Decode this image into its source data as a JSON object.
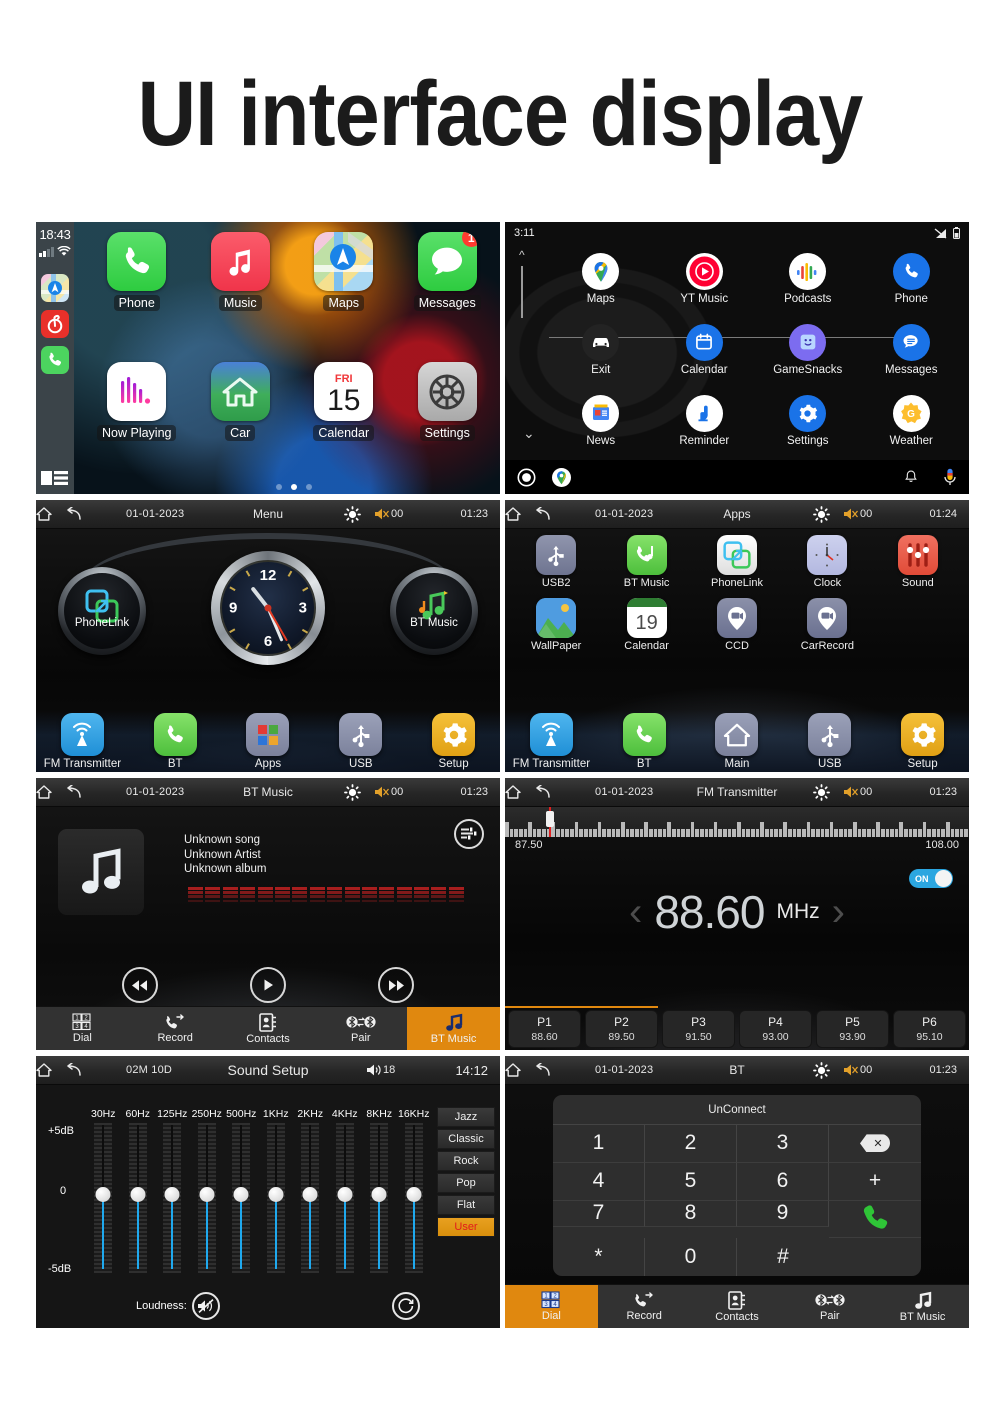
{
  "page": {
    "title": "UI interface display"
  },
  "colors": {
    "accent_orange": "#e0880f",
    "toggle_blue": "#2ba6e0",
    "slider_blue": "#1fa9ee",
    "eq_red": "#b02020",
    "badge_red": "#ff3b30"
  },
  "carplay": {
    "status": {
      "time": "18:43",
      "signal_icon": "cellular-signal-icon",
      "wifi_icon": "wifi-icon"
    },
    "sidebar_apps": [
      {
        "name": "maps-icon",
        "label": "Maps"
      },
      {
        "name": "netease-music-icon",
        "label": "NetEase Music"
      },
      {
        "name": "phone-icon",
        "label": "Phone"
      }
    ],
    "sidebar_list_button": "app-list-icon",
    "apps": [
      {
        "label": "Phone",
        "icon": "phone-icon",
        "badge": ""
      },
      {
        "label": "Music",
        "icon": "music-note-icon",
        "badge": ""
      },
      {
        "label": "Maps",
        "icon": "maps-icon",
        "badge": ""
      },
      {
        "label": "Messages",
        "icon": "messages-bubble-icon",
        "badge": "1"
      },
      {
        "label": "Now Playing",
        "icon": "now-playing-icon",
        "badge": ""
      },
      {
        "label": "Car",
        "icon": "home-house-icon",
        "badge": ""
      },
      {
        "label": "Calendar",
        "icon": "calendar-icon",
        "badge": "",
        "day_name": "FRI",
        "day_num": "15"
      },
      {
        "label": "Settings",
        "icon": "gear-icon",
        "badge": ""
      }
    ],
    "page_dots": 3,
    "page_active": 2
  },
  "androidauto": {
    "status": {
      "time": "3:11",
      "signal_icon": "no-signal-icon",
      "battery_icon": "battery-icon"
    },
    "apps": [
      {
        "label": "Maps",
        "icon": "google-maps-icon"
      },
      {
        "label": "YT Music",
        "icon": "youtube-music-icon"
      },
      {
        "label": "Podcasts",
        "icon": "google-podcasts-icon"
      },
      {
        "label": "Phone",
        "icon": "phone-icon"
      },
      {
        "label": "Exit",
        "icon": "car-exit-icon"
      },
      {
        "label": "Calendar",
        "icon": "calendar-icon"
      },
      {
        "label": "GameSnacks",
        "icon": "gamesnacks-icon"
      },
      {
        "label": "Messages",
        "icon": "messages-icon"
      },
      {
        "label": "News",
        "icon": "google-news-icon"
      },
      {
        "label": "Reminder",
        "icon": "reminder-icon"
      },
      {
        "label": "Settings",
        "icon": "gear-icon"
      },
      {
        "label": "Weather",
        "icon": "weather-icon"
      }
    ],
    "bottom_bar": {
      "home_icon": "home-circle-icon",
      "maps_icon": "google-maps-icon",
      "notification_icon": "bell-icon",
      "mic_icon": "assistant-mic-icon"
    },
    "scroll_up_icon": "chevron-up-icon",
    "scroll_down_icon": "chevron-down-icon"
  },
  "menu": {
    "topbar": {
      "home_icon": "home-icon",
      "back_icon": "back-arrow-icon",
      "date": "01-01-2023",
      "title": "Menu",
      "brightness_icon": "brightness-icon",
      "volume_icon": "volume-mute-icon",
      "volume": "00",
      "time": "01:23"
    },
    "left_gauge": {
      "label": "PhoneLink",
      "icon": "phonelink-icon"
    },
    "right_gauge": {
      "label": "BT Music",
      "icon": "music-note-icon"
    },
    "clock": {
      "numerals": [
        "12",
        "3",
        "6",
        "9"
      ]
    },
    "dock": [
      {
        "label": "FM Transmitter",
        "icon": "fm-antenna-icon"
      },
      {
        "label": "BT",
        "icon": "phone-icon"
      },
      {
        "label": "Apps",
        "icon": "apps-grid-icon"
      },
      {
        "label": "USB",
        "icon": "usb-icon"
      },
      {
        "label": "Setup",
        "icon": "gear-icon"
      }
    ]
  },
  "apps": {
    "topbar": {
      "home_icon": "home-icon",
      "back_icon": "back-arrow-icon",
      "date": "01-01-2023",
      "title": "Apps",
      "brightness_icon": "brightness-icon",
      "volume_icon": "volume-mute-icon",
      "volume": "00",
      "time": "01:24"
    },
    "items": [
      {
        "label": "USB2",
        "icon": "usb-icon"
      },
      {
        "label": "BT Music",
        "icon": "bt-music-icon"
      },
      {
        "label": "PhoneLink",
        "icon": "phonelink-icon"
      },
      {
        "label": "Clock",
        "icon": "clock-icon"
      },
      {
        "label": "Sound",
        "icon": "sound-sliders-icon"
      },
      {
        "label": "WallPaper",
        "icon": "wallpaper-icon"
      },
      {
        "label": "Calendar",
        "icon": "calendar-icon",
        "day_num": "19"
      },
      {
        "label": "CCD",
        "icon": "camera-pin-icon"
      },
      {
        "label": "CarRecord",
        "icon": "camera-pin-icon"
      }
    ],
    "dock": [
      {
        "label": "FM Transmitter",
        "icon": "fm-antenna-icon"
      },
      {
        "label": "BT",
        "icon": "phone-icon"
      },
      {
        "label": "Main",
        "icon": "home-house-icon"
      },
      {
        "label": "USB",
        "icon": "usb-icon"
      },
      {
        "label": "Setup",
        "icon": "gear-icon"
      }
    ]
  },
  "btmusic": {
    "topbar": {
      "home_icon": "home-icon",
      "back_icon": "back-arrow-icon",
      "date": "01-01-2023",
      "title": "BT Music",
      "brightness_icon": "brightness-icon",
      "volume_icon": "volume-mute-icon",
      "volume": "00",
      "time": "01:23"
    },
    "album_art_icon": "music-note-icon",
    "track": {
      "song": "Unknown song",
      "artist": "Unknown Artist",
      "album": "Unknown album"
    },
    "eq_button_icon": "equalizer-icon",
    "transport": [
      {
        "name": "previous-track-button",
        "icon": "prev-icon"
      },
      {
        "name": "play-button",
        "icon": "play-icon"
      },
      {
        "name": "next-track-button",
        "icon": "next-icon"
      }
    ],
    "nav": [
      {
        "label": "Dial",
        "icon": "dialpad-icon",
        "active": false
      },
      {
        "label": "Record",
        "icon": "call-record-icon",
        "active": false
      },
      {
        "label": "Contacts",
        "icon": "contacts-book-icon",
        "active": false
      },
      {
        "label": "Pair",
        "icon": "bluetooth-pair-icon",
        "active": false
      },
      {
        "label": "BT Music",
        "icon": "music-note-icon",
        "active": true
      }
    ]
  },
  "fm": {
    "topbar": {
      "home_icon": "home-icon",
      "back_icon": "back-arrow-icon",
      "date": "01-01-2023",
      "title": "FM Transmitter",
      "brightness_icon": "brightness-icon",
      "volume_icon": "volume-mute-icon",
      "volume": "00",
      "time": "01:23"
    },
    "range_min": "87.50",
    "range_max": "108.00",
    "frequency": "88.60",
    "unit": "MHz",
    "toggle": {
      "label": "ON",
      "state": "on"
    },
    "prev_icon": "chevron-left-icon",
    "next_icon": "chevron-right-icon",
    "presets": [
      {
        "name": "P1",
        "freq": "88.60"
      },
      {
        "name": "P2",
        "freq": "89.50"
      },
      {
        "name": "P3",
        "freq": "91.50"
      },
      {
        "name": "P4",
        "freq": "93.00"
      },
      {
        "name": "P5",
        "freq": "93.90"
      },
      {
        "name": "P6",
        "freq": "95.10"
      }
    ]
  },
  "sound": {
    "topbar": {
      "home_icon": "home-icon",
      "back_icon": "back-arrow-icon",
      "date": "02M 10D",
      "title": "Sound Setup",
      "volume_icon": "volume-on-icon",
      "volume": "18",
      "time": "14:12"
    },
    "db_labels": {
      "top": "+5dB",
      "mid": "0",
      "bottom": "-5dB"
    },
    "bands": [
      "30Hz",
      "60Hz",
      "125Hz",
      "250Hz",
      "500Hz",
      "1KHz",
      "2KHz",
      "4KHz",
      "8KHz",
      "16KHz"
    ],
    "band_values": [
      0,
      0,
      0,
      0,
      0,
      0,
      0,
      0,
      0,
      0
    ],
    "presets": [
      {
        "label": "Jazz",
        "selected": false
      },
      {
        "label": "Classic",
        "selected": false
      },
      {
        "label": "Rock",
        "selected": false
      },
      {
        "label": "Pop",
        "selected": false
      },
      {
        "label": "Flat",
        "selected": false
      },
      {
        "label": "User",
        "selected": true
      }
    ],
    "loudness_label": "Loudness:",
    "loudness_icon": "speaker-muted-icon",
    "reset_icon": "reset-circle-icon"
  },
  "bt": {
    "topbar": {
      "home_icon": "home-icon",
      "back_icon": "back-arrow-icon",
      "date": "01-01-2023",
      "title": "BT",
      "brightness_icon": "brightness-icon",
      "volume_icon": "volume-mute-icon",
      "volume": "00",
      "time": "01:23"
    },
    "connection_status": "UnConnect",
    "keys": [
      "1",
      "2",
      "3",
      "4",
      "5",
      "6",
      "7",
      "8",
      "9",
      "*",
      "0",
      "#"
    ],
    "backspace_icon": "backspace-icon",
    "plus_key": "+",
    "call_icon": "call-handset-icon",
    "nav": [
      {
        "label": "Dial",
        "icon": "dialpad-icon",
        "active": true
      },
      {
        "label": "Record",
        "icon": "call-record-icon",
        "active": false
      },
      {
        "label": "Contacts",
        "icon": "contacts-book-icon",
        "active": false
      },
      {
        "label": "Pair",
        "icon": "bluetooth-pair-icon",
        "active": false
      },
      {
        "label": "BT Music",
        "icon": "music-note-icon",
        "active": false
      }
    ]
  }
}
